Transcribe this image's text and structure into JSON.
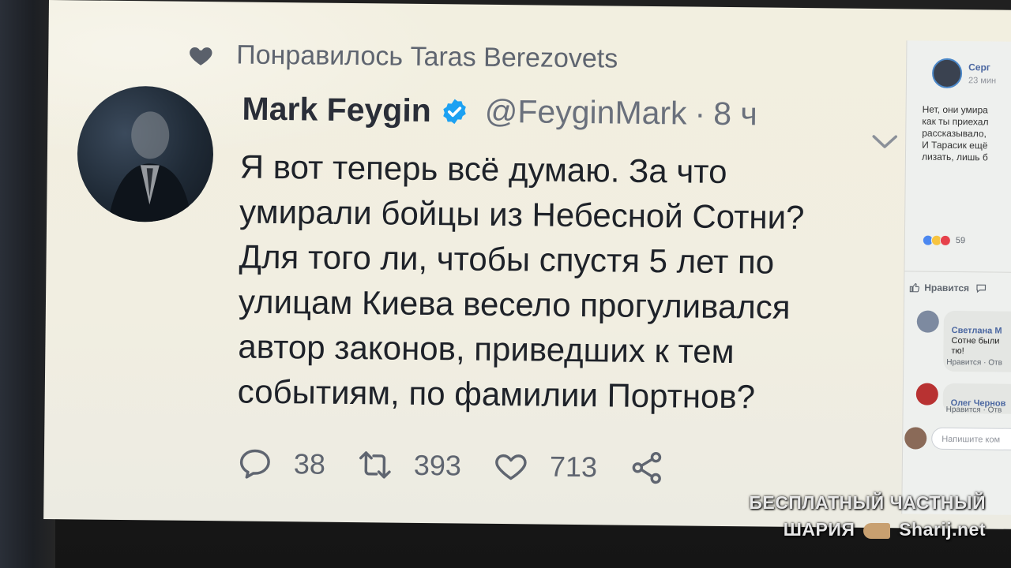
{
  "liked_by": "Понравилось Taras Berezovets",
  "tweet": {
    "display_name": "Mark Feygin",
    "handle": "@FeyginMark",
    "separator": "·",
    "time": "8 ч",
    "text": "Я вот теперь всё думаю. За что\nумирали бойцы из Небесной Сотни?\nДля того ли, чтобы спустя 5 лет по\nулицам Киева весело прогуливался\nавтор законов, приведших к тем\nсобытиям, по фамилии Портнов?",
    "replies": "38",
    "retweets": "393",
    "likes": "713"
  },
  "facebook": {
    "author": "Серг",
    "time": "23 мин",
    "text": "Нет, они умира\nкак ты приехал\nрассказывало,\nИ Тарасик ещё\nлизать, лишь б",
    "reaction_count": "59",
    "reaction_colors": [
      "#4c88f0",
      "#f7c440",
      "#e6414b"
    ],
    "like_label": "Нравится",
    "comments": [
      {
        "name": "Светлана М",
        "text": "Сотне были\nтю!",
        "actions": "Нравится · Отв"
      },
      {
        "name": "Олег Чернов",
        "text": "",
        "actions": "Нравится · Отв"
      }
    ],
    "input_placeholder": "Напишите ком"
  },
  "watermark": {
    "line1": "БЕСПЛАТНЫЙ ЧАСТНЫЙ",
    "line2_left": "ШАРИЯ",
    "line2_right": "Sharij.net"
  },
  "colors": {
    "verified": "#1da1f2",
    "link_facebook": "#4b67a1",
    "text_primary": "#1e2229",
    "text_secondary": "#5f6570"
  }
}
